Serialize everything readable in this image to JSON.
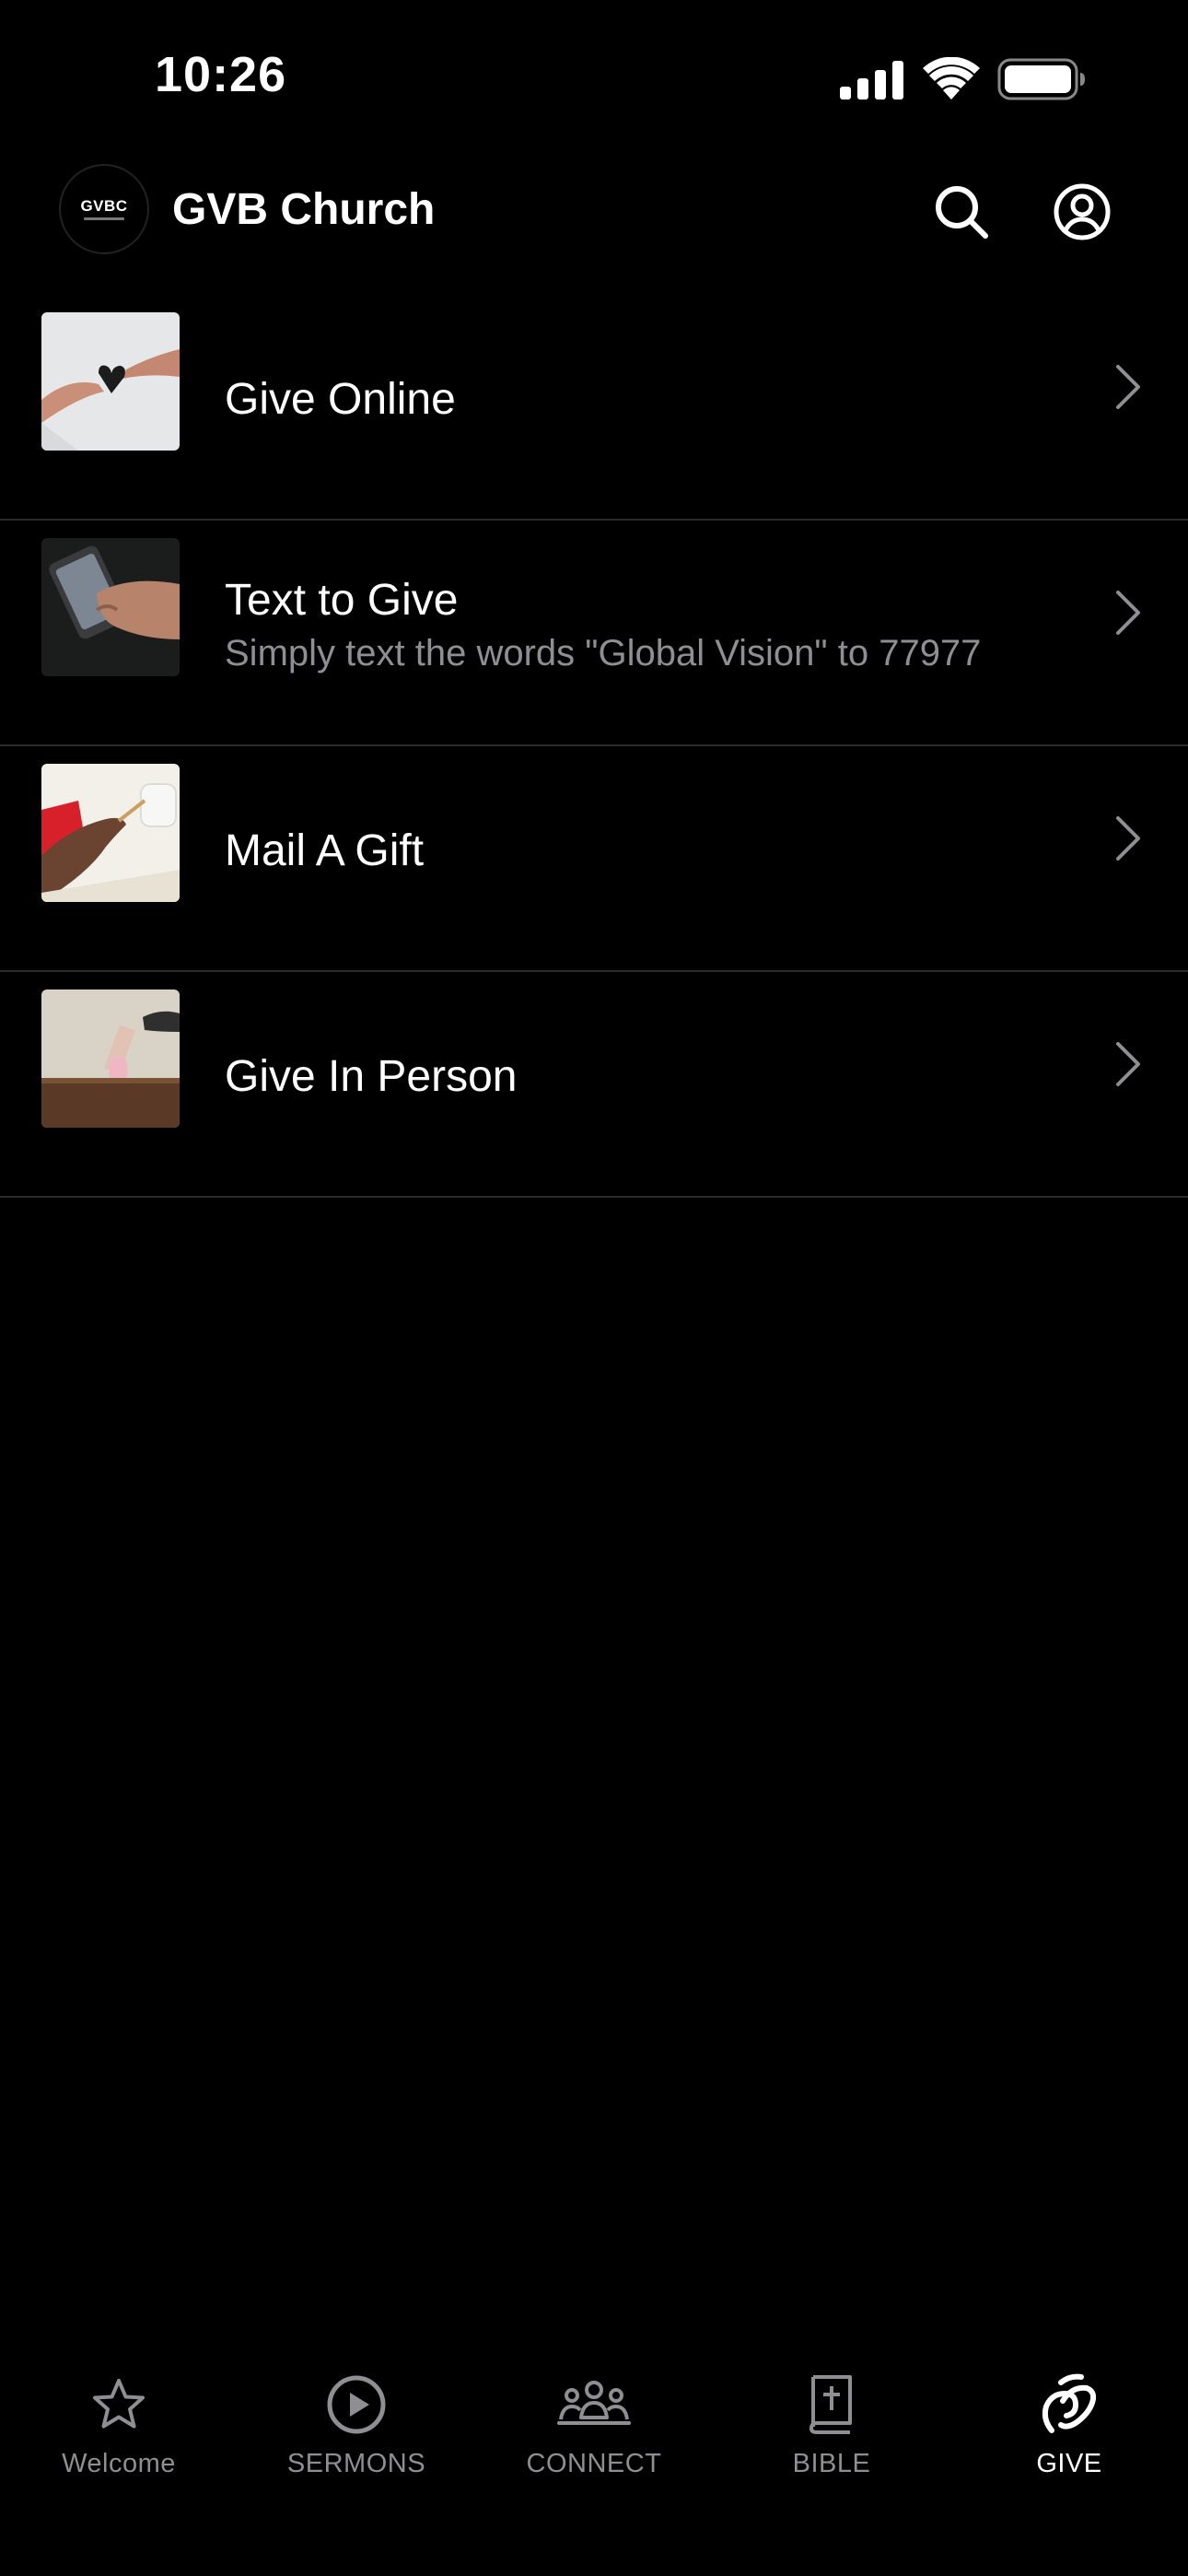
{
  "status_bar": {
    "time": "10:26"
  },
  "header": {
    "logo_text": "GVBC",
    "church_name": "GVB Church",
    "icons": [
      "search-icon",
      "profile-icon"
    ]
  },
  "give_items": [
    {
      "title": "Give Online",
      "subtitle": "",
      "thumb": "hands-heart-photo"
    },
    {
      "title": "Text to Give",
      "subtitle": "Simply text the words \"Global Vision\" to 77977",
      "thumb": "phone-in-hand-photo"
    },
    {
      "title": "Mail A Gift",
      "subtitle": "",
      "thumb": "writing-hand-photo"
    },
    {
      "title": "Give In Person",
      "subtitle": "",
      "thumb": "offering-box-photo"
    }
  ],
  "tab_bar": {
    "tabs": [
      {
        "label": "Welcome",
        "icon": "star-icon",
        "active": false
      },
      {
        "label": "SERMONS",
        "icon": "play-circle-icon",
        "active": false
      },
      {
        "label": "CONNECT",
        "icon": "people-icon",
        "active": false
      },
      {
        "label": "BIBLE",
        "icon": "bible-icon",
        "active": false
      },
      {
        "label": "GIVE",
        "icon": "give-icon",
        "active": true
      }
    ]
  },
  "colors": {
    "background": "#000000",
    "text_primary": "#ffffff",
    "text_secondary": "#8e8e93",
    "divider": "#2b2b2d"
  }
}
